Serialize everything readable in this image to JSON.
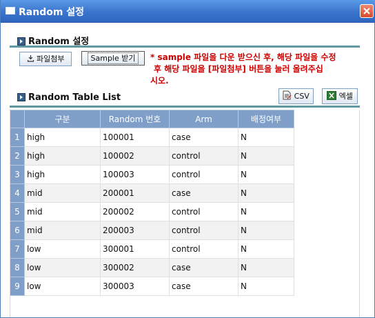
{
  "window": {
    "title": "Random 설정"
  },
  "settings_section": {
    "title": "Random 설정"
  },
  "buttons": {
    "attach": "파일첨부",
    "sample": "Sample 받기",
    "csv": "CSV",
    "excel": "엑셀"
  },
  "notice": {
    "line1": "* sample 파일을 다운 받으신 후, 해당 파일을 수정",
    "line2": "후 해당 파일을 [파일첨부] 버튼을 눌러 올려주십",
    "line3": "시오."
  },
  "table_section": {
    "title": "Random Table List"
  },
  "table": {
    "columns": [
      "구분",
      "Random 번호",
      "Arm",
      "배정여부"
    ],
    "rows": [
      {
        "num": "1",
        "group": "high",
        "random_no": "100001",
        "arm": "case",
        "assigned": "N"
      },
      {
        "num": "2",
        "group": "high",
        "random_no": "100002",
        "arm": "control",
        "assigned": "N"
      },
      {
        "num": "3",
        "group": "high",
        "random_no": "100003",
        "arm": "control",
        "assigned": "N"
      },
      {
        "num": "4",
        "group": "mid",
        "random_no": "200001",
        "arm": "case",
        "assigned": "N"
      },
      {
        "num": "5",
        "group": "mid",
        "random_no": "200002",
        "arm": "control",
        "assigned": "N"
      },
      {
        "num": "6",
        "group": "mid",
        "random_no": "200003",
        "arm": "control",
        "assigned": "N"
      },
      {
        "num": "7",
        "group": "low",
        "random_no": "300001",
        "arm": "control",
        "assigned": "N"
      },
      {
        "num": "8",
        "group": "low",
        "random_no": "300002",
        "arm": "case",
        "assigned": "N"
      },
      {
        "num": "9",
        "group": "low",
        "random_no": "300003",
        "arm": "case",
        "assigned": "N"
      }
    ]
  },
  "icons": {
    "window": "window-icon",
    "close": "close-icon",
    "section": "section-bullet-icon",
    "attach": "download-icon",
    "csv": "csv-file-icon",
    "excel": "excel-icon"
  }
}
